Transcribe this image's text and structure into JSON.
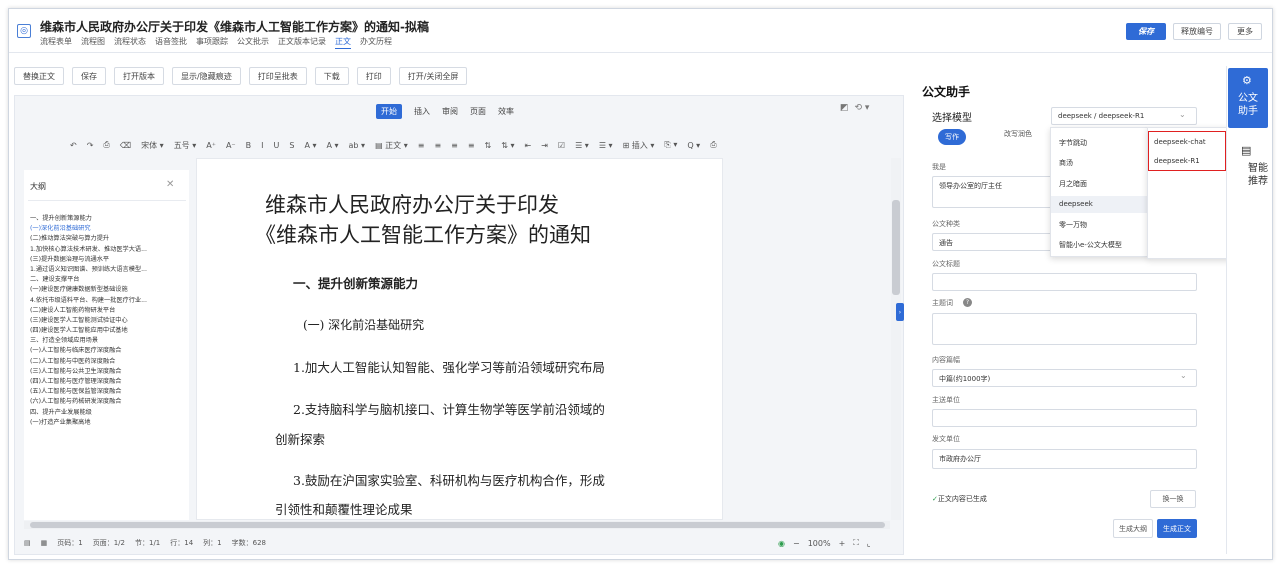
{
  "header": {
    "title": "维森市人民政府办公厅关于印发《维森市人工智能工作方案》的通知-拟稿",
    "tabs": [
      "流程表单",
      "流程图",
      "流程状态",
      "语音签批",
      "事项跟踪",
      "公文批示",
      "正文版本记录",
      "正文",
      "办文历程"
    ],
    "active_tab": "正文",
    "save": "保存",
    "release_number": "释放编号",
    "more": "更多"
  },
  "toolbar": [
    "替换正文",
    "保存",
    "打开版本",
    "显示/隐藏痕迹",
    "打印呈批表",
    "下载",
    "打印",
    "打开/关闭全屏"
  ],
  "ribbon": {
    "tabs": [
      "开始",
      "插入",
      "审阅",
      "页面",
      "效率"
    ],
    "active": "开始",
    "tools": [
      "↶",
      "↷",
      "⎙",
      "⌫",
      "宋体 ▾",
      "五号 ▾",
      "A⁺",
      "A⁻",
      "B",
      "I",
      "U",
      "S",
      "A ▾",
      "A ▾",
      "ab ▾",
      "▤ 正文 ▾",
      "≡",
      "≡",
      "≡",
      "≡",
      "⇅",
      "⇅ ▾",
      "⇤",
      "⇥",
      "☑",
      "☰ ▾",
      "☰ ▾",
      "⊞ 插入 ▾",
      "⎘ ▾",
      "Q ▾",
      "⎙"
    ]
  },
  "outline": {
    "title": "大纲",
    "items": [
      {
        "text": "一、提升创新策源能力",
        "sel": false
      },
      {
        "text": "(一)深化前沿基础研究",
        "sel": true
      },
      {
        "text": "(二)推动算法突破与算力提升",
        "sel": false
      },
      {
        "text": "1.加快核心算法技术研发、推动医学大语...",
        "sel": false
      },
      {
        "text": "(三)提升数据治理与流通水平",
        "sel": false
      },
      {
        "text": "1.通过语义知识图谱、预训练大语言模型...",
        "sel": false
      },
      {
        "text": "二、建设支撑平台",
        "sel": false
      },
      {
        "text": "(一)建设医疗健康数据新型基础设施",
        "sel": false
      },
      {
        "text": "4.依托市级语料平台、构建一批医疗行业...",
        "sel": false
      },
      {
        "text": "(二)建设人工智能药物研发平台",
        "sel": false
      },
      {
        "text": "(三)建设医学人工智能测试验证中心",
        "sel": false
      },
      {
        "text": "(四)建设医学人工智能应用中试基地",
        "sel": false
      },
      {
        "text": "三、打造全领域应用场景",
        "sel": false
      },
      {
        "text": "(一)人工智能与临床医疗深度融合",
        "sel": false
      },
      {
        "text": "(二)人工智能与中医药深度融合",
        "sel": false
      },
      {
        "text": "(三)人工智能与公共卫生深度融合",
        "sel": false
      },
      {
        "text": "(四)人工智能与医疗管理深度融合",
        "sel": false
      },
      {
        "text": "(五)人工智能与医保监管深度融合",
        "sel": false
      },
      {
        "text": "(六)人工智能与药械研发深度融合",
        "sel": false
      },
      {
        "text": "四、提升产业发展能级",
        "sel": false
      },
      {
        "text": "(一)打造产业集聚高地",
        "sel": false
      }
    ]
  },
  "page": {
    "title_line1": "维森市人民政府办公厅关于印发",
    "title_line2": "《维森市人工智能工作方案》的通知",
    "heading1": "一、提升创新策源能力",
    "heading2": "(一) 深化前沿基础研究",
    "p1": "1.加大人工智能认知智能、强化学习等前沿领域研究布局",
    "p2a": "2.支持脑科学与脑机接口、计算生物学等医学前沿领域的",
    "p2b": "创新探索",
    "p3a": "3.鼓励在沪国家实验室、科研机构与医疗机构合作，形成",
    "p3b": "引领性和颠覆性理论成果"
  },
  "status": {
    "page": "页码：1",
    "pages": "页面：1/2",
    "section": "节：1/1",
    "row": "行：14",
    "col": "列：1",
    "words": "字数：628",
    "zoom": "100%"
  },
  "assistant": {
    "title": "公文助手",
    "model_label": "选择模型",
    "model_value": "deepseek / deepseek-R1",
    "mode_write": "写作",
    "mode_polish": "改写润色",
    "i_am_label": "我是",
    "i_am_value": "领导办公室的厅主任",
    "doc_type_label": "公文种类",
    "doc_type_value": "通告",
    "doc_title_label": "公文标题",
    "keywords_label": "主题词",
    "length_label": "内容篇幅",
    "length_value": "中篇(约1000字)",
    "main_unit_label": "主送单位",
    "issuer_label": "发文单位",
    "issuer_value": "市政府办公厅",
    "generated": "正文内容已生成",
    "swap": "换一换",
    "gen_outline": "生成大纲",
    "gen_text": "生成正文"
  },
  "model_dropdown": {
    "providers": [
      "字节跳动",
      "商汤",
      "月之暗面",
      "deepseek",
      "零一万物",
      "智能小e-公文大模型"
    ],
    "highlighted": "deepseek",
    "models": [
      "deepseek-chat",
      "deepseek-R1"
    ]
  },
  "rail": {
    "assistant_label": "公文\n助手",
    "recommend_label": "智能\n推荐"
  }
}
